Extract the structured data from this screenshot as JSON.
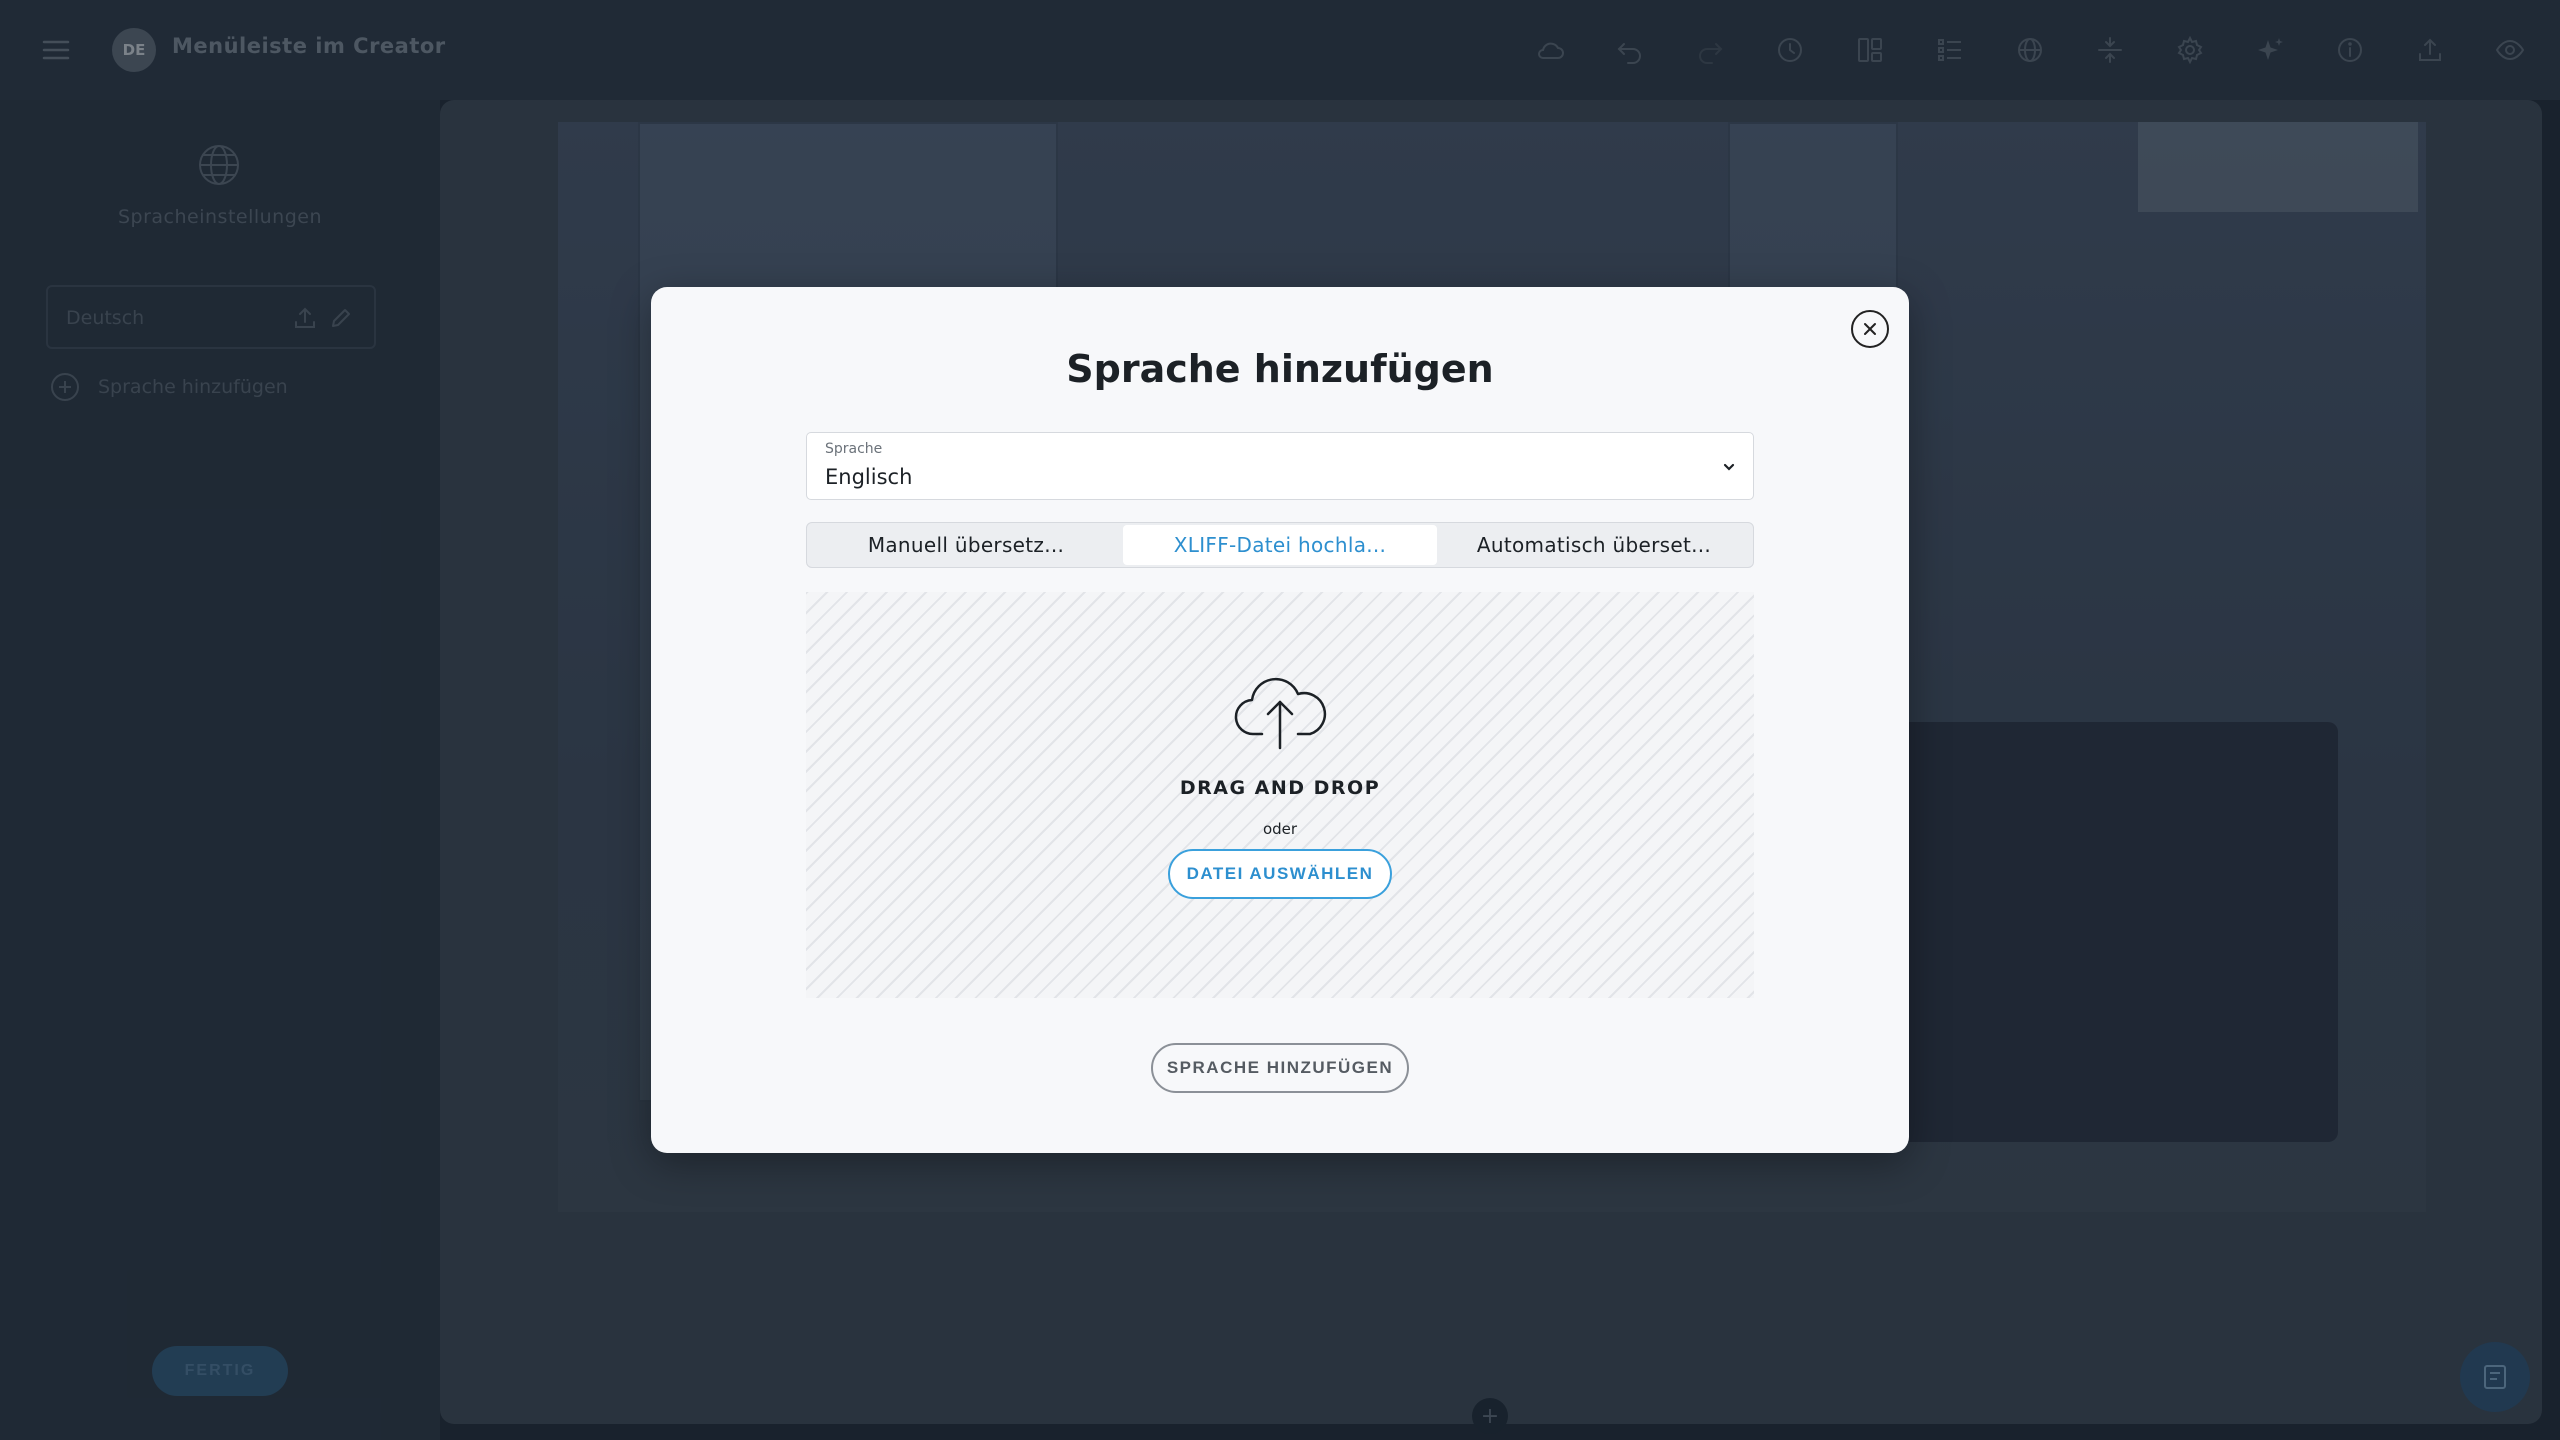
{
  "topbar": {
    "avatar_initials": "DE",
    "project_title": "Menüleiste im Creator",
    "tools": [
      "cloud-icon",
      "undo-icon",
      "redo-icon",
      "history-icon",
      "layout-icon",
      "list-icon",
      "globe-icon",
      "spacing-icon",
      "settings-icon",
      "sparkle-icon",
      "info-icon",
      "upload-icon",
      "preview-icon"
    ]
  },
  "sidebar": {
    "section_label": "Spracheinstellungen",
    "languages": [
      {
        "name": "Deutsch"
      }
    ],
    "add_language_label": "Sprache hinzufügen",
    "done_label": "FERTIG"
  },
  "modal": {
    "title": "Sprache hinzufügen",
    "select": {
      "label": "Sprache",
      "value": "Englisch"
    },
    "tabs": [
      {
        "label": "Manuell übersetz..."
      },
      {
        "label": "XLIFF-Datei hochla..."
      },
      {
        "label": "Automatisch überset..."
      }
    ],
    "active_tab": 1,
    "dropzone": {
      "heading": "DRAG AND DROP",
      "or_label": "oder",
      "choose_button": "DATEI AUSWÄHLEN"
    },
    "submit_label": "SPRACHE HINZUFÜGEN"
  },
  "colors": {
    "accent": "#2d8fcf",
    "modal_bg": "#f7f8fa",
    "page_bg": "#1e2733"
  }
}
